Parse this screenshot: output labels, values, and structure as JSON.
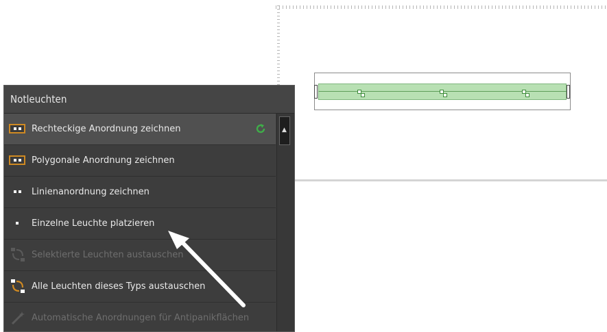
{
  "panel": {
    "title": "Notleuchten",
    "items": [
      {
        "label": "Rechteckige Anordnung zeichnen",
        "icon": "rectangle-arrangement-icon",
        "enabled": true
      },
      {
        "label": "Polygonale Anordnung zeichnen",
        "icon": "polygon-arrangement-icon",
        "enabled": true
      },
      {
        "label": "Linienanordnung zeichnen",
        "icon": "line-arrangement-icon",
        "enabled": true
      },
      {
        "label": "Einzelne Leuchte platzieren",
        "icon": "single-luminaire-icon",
        "enabled": true
      },
      {
        "label": "Selektierte Leuchten austauschen",
        "icon": "swap-selected-icon",
        "enabled": false
      },
      {
        "label": "Alle Leuchten dieses Typs austauschen",
        "icon": "swap-all-icon",
        "enabled": true
      },
      {
        "label": "Automatische Anordnungen für Antipanikflächen",
        "icon": "wand-icon",
        "enabled": false
      }
    ]
  },
  "colors": {
    "panel_bg": "#3d3d3d",
    "accent_orange": "#d08a22",
    "refresh_green": "#3fae49",
    "room_fill": "#b8e0b3"
  }
}
